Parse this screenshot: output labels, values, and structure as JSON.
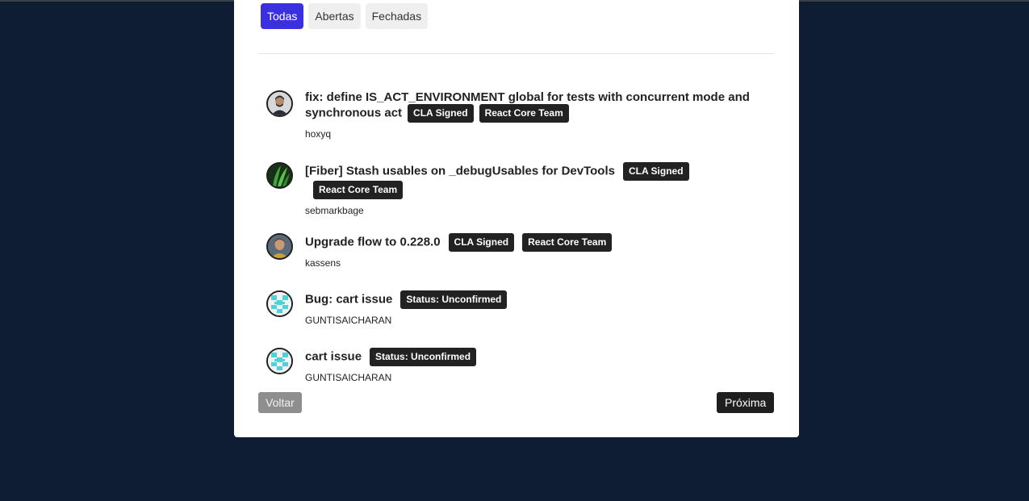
{
  "filters": {
    "all_label": "Todas",
    "open_label": "Abertas",
    "closed_label": "Fechadas",
    "active": "Todas"
  },
  "issues": [
    {
      "title": "fix: define IS_ACT_ENVIRONMENT global for tests with concurrent mode and synchronous act",
      "labels": [
        "CLA Signed",
        "React Core Team"
      ],
      "author": "hoxyq",
      "avatar": "photo-avatar"
    },
    {
      "title": "[Fiber] Stash usables on _debugUsables for DevTools",
      "labels": [
        "CLA Signed",
        "React Core Team"
      ],
      "author": "sebmarkbage",
      "avatar": "leaf-avatar"
    },
    {
      "title": "Upgrade flow to 0.228.0",
      "labels": [
        "CLA Signed",
        "React Core Team"
      ],
      "author": "kassens",
      "avatar": "photo-avatar"
    },
    {
      "title": "Bug: cart issue",
      "labels": [
        "Status: Unconfirmed"
      ],
      "author": "GUNTISAICHARAN",
      "avatar": "identicon-avatar"
    },
    {
      "title": "cart issue",
      "labels": [
        "Status: Unconfirmed"
      ],
      "author": "GUNTISAICHARAN",
      "avatar": "identicon-avatar"
    }
  ],
  "pagination": {
    "back_label": "Voltar",
    "next_label": "Próxima"
  },
  "colors": {
    "background": "#0f1d33",
    "active_filter": "#3b30e0",
    "badge": "#222222",
    "identicon": "#4fd1d9"
  }
}
